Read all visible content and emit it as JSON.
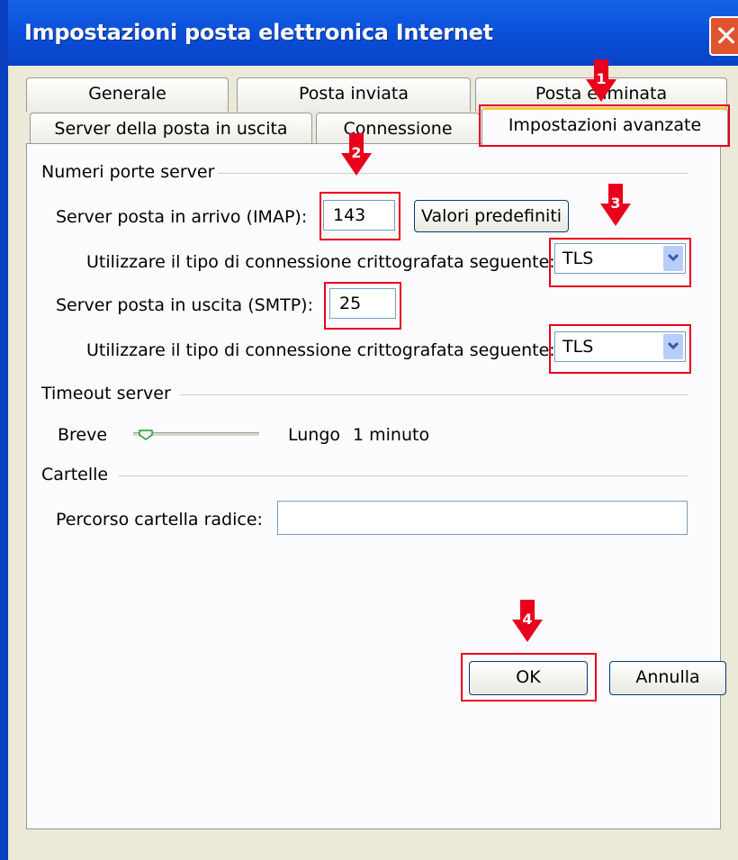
{
  "window": {
    "title": "Impostazioni posta elettronica Internet"
  },
  "tabs": {
    "row_back": [
      "Generale",
      "Posta inviata",
      "Posta eliminata"
    ],
    "row_front": [
      "Server della posta in uscita",
      "Connessione",
      "Impostazioni avanzate"
    ]
  },
  "ports": {
    "group_label": "Numeri porte server",
    "imap_label": "Server posta in arrivo (IMAP):",
    "imap_value": "143",
    "defaults_button": "Valori predefiniti",
    "encryption_label_1": "Utilizzare il tipo di connessione crittografata seguente:",
    "encryption_value_1": "TLS",
    "smtp_label": "Server posta in uscita (SMTP):",
    "smtp_value": "25",
    "encryption_label_2": "Utilizzare il tipo di connessione crittografata seguente:",
    "encryption_value_2": "TLS"
  },
  "timeout": {
    "group_label": "Timeout server",
    "short_label": "Breve",
    "long_label": "Lungo",
    "value_text": "1 minuto",
    "slider_fraction": 0.0
  },
  "folders": {
    "group_label": "Cartelle",
    "root_label": "Percorso cartella radice:",
    "root_value": ""
  },
  "buttons": {
    "ok": "OK",
    "cancel": "Annulla"
  },
  "markers": [
    "1",
    "2",
    "3",
    "4"
  ],
  "colors": {
    "highlight": "#e8001c",
    "marker": "#e8001c",
    "titlebar": "#0a4ed8",
    "dialog": "#ece9d8"
  }
}
